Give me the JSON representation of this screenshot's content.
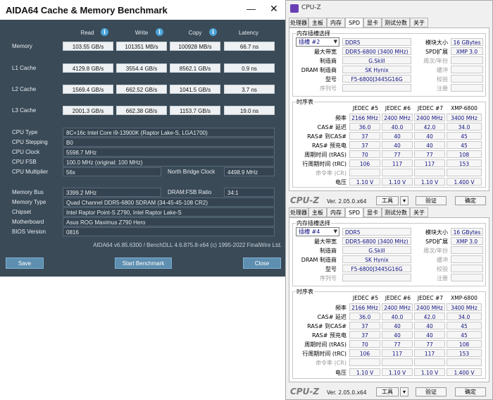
{
  "aida": {
    "title": "AIDA64 Cache & Memory Benchmark",
    "min_glyph": "—",
    "close_glyph": "✕",
    "headers": [
      "Read",
      "Write",
      "Copy",
      "Latency"
    ],
    "info_glyph": "i",
    "rows": [
      {
        "label": "Memory",
        "read": "103.55 GB/s",
        "write": "101351 MB/s",
        "copy": "100928 MB/s",
        "latency": "66.7 ns"
      },
      {
        "label": "L1 Cache",
        "read": "4129.8 GB/s",
        "write": "3554.4 GB/s",
        "copy": "8562.1 GB/s",
        "latency": "0.9 ns"
      },
      {
        "label": "L2 Cache",
        "read": "1569.4 GB/s",
        "write": "662.52 GB/s",
        "copy": "1041.5 GB/s",
        "latency": "3.7 ns"
      },
      {
        "label": "L3 Cache",
        "read": "2001.3 GB/s",
        "write": "662.38 GB/s",
        "copy": "1153.7 GB/s",
        "latency": "19.0 ns"
      }
    ],
    "cpu": {
      "type_label": "CPU Type",
      "type": "8C+16c Intel Core i9-13900K  (Raptor Lake-S, LGA1700)",
      "stepping_label": "CPU Stepping",
      "stepping": "B0",
      "clock_label": "CPU Clock",
      "clock": "5598.7 MHz",
      "fsb_label": "CPU FSB",
      "fsb": "100.0 MHz  (original: 100 MHz)",
      "mult_label": "CPU Multiplier",
      "mult": "56x",
      "nb_label": "North Bridge Clock",
      "nb": "4498.9 MHz"
    },
    "mem": {
      "bus_label": "Memory Bus",
      "bus": "3399.2 MHz",
      "ratio_label": "DRAM:FSB Ratio",
      "ratio": "34:1",
      "type_label": "Memory Type",
      "type": "Quad Channel DDR5-6800 SDRAM  (34-45-45-108 CR2)",
      "chipset_label": "Chipset",
      "chipset": "Intel Raptor Point-S Z790, Intel Raptor Lake-S",
      "mb_label": "Motherboard",
      "mb": "Asus ROG Maximus Z790 Hero",
      "bios_label": "BIOS Version",
      "bios": "0816"
    },
    "footer": "AIDA64 v6.85.6300 / BenchDLL 4.6.875.8-x64  (c) 1995-2022 FinalWire Ltd.",
    "buttons": {
      "save": "Save",
      "start": "Start Benchmark",
      "close": "Close"
    }
  },
  "cpuz_title": "CPU-Z",
  "cpuz_tabs": [
    "处理器",
    "主板",
    "内存",
    "SPD",
    "显卡",
    "测试分数",
    "关于"
  ],
  "cpuz": [
    {
      "slot_group": "内存插槽选择",
      "slot": "插槽 #2",
      "type": "DDR5",
      "module_size_label": "模块大小",
      "module_size": "16 GBytes",
      "max_bw_label": "最大带宽",
      "max_bw": "DDR5-6800 (3400 MHz)",
      "spd_ext_label": "SPD扩展",
      "spd_ext": "XMP 3.0",
      "maker_label": "制造商",
      "maker": "G.Skill",
      "week_year_label": "周次/年份",
      "dram_maker_label": "DRAM 制造商",
      "dram_maker": "SK Hynix",
      "buffered_label": "缓冲",
      "part_label": "型号",
      "part": "F5-6800J3445G16G",
      "correction_label": "校验",
      "serial_label": "序列号",
      "registered_label": "注册",
      "timing_group": "时序表",
      "timing_cols": [
        "JEDEC #5",
        "JEDEC #6",
        "JEDEC #7",
        "XMP-6800"
      ],
      "timing_rows": [
        {
          "label": "频率",
          "vals": [
            "2166 MHz",
            "2400 MHz",
            "2400 MHz",
            "3400 MHz"
          ]
        },
        {
          "label": "CAS# 延迟",
          "vals": [
            "36.0",
            "40.0",
            "42.0",
            "34.0"
          ]
        },
        {
          "label": "RAS# 到CAS#",
          "vals": [
            "37",
            "40",
            "40",
            "45"
          ]
        },
        {
          "label": "RAS# 预充电",
          "vals": [
            "37",
            "40",
            "40",
            "45"
          ]
        },
        {
          "label": "周期时间 (tRAS)",
          "vals": [
            "70",
            "77",
            "77",
            "108"
          ]
        },
        {
          "label": "行周期时间 (tRC)",
          "vals": [
            "106",
            "117",
            "117",
            "153"
          ]
        },
        {
          "label": "命令率 (CR)",
          "vals": [
            "",
            "",
            "",
            ""
          ]
        },
        {
          "label": "电压",
          "vals": [
            "1.10 V",
            "1.10 V",
            "1.10 V",
            "1.400 V"
          ]
        }
      ],
      "version": "Ver. 2.05.0.x64",
      "tools": "工具",
      "validate": "验证",
      "ok": "确定"
    },
    {
      "slot_group": "内存插槽选择",
      "slot": "插槽 #4",
      "type": "DDR5",
      "module_size_label": "模块大小",
      "module_size": "16 GBytes",
      "max_bw_label": "最大带宽",
      "max_bw": "DDR5-6800 (3400 MHz)",
      "spd_ext_label": "SPD扩展",
      "spd_ext": "XMP 3.0",
      "maker_label": "制造商",
      "maker": "G.Skill",
      "week_year_label": "周次/年份",
      "dram_maker_label": "DRAM 制造商",
      "dram_maker": "SK Hynix",
      "buffered_label": "缓冲",
      "part_label": "型号",
      "part": "F5-6800J3445G16G",
      "correction_label": "校验",
      "serial_label": "序列号",
      "registered_label": "注册",
      "timing_group": "时序表",
      "timing_cols": [
        "JEDEC #5",
        "JEDEC #6",
        "JEDEC #7",
        "XMP-6800"
      ],
      "timing_rows": [
        {
          "label": "频率",
          "vals": [
            "2166 MHz",
            "2400 MHz",
            "2400 MHz",
            "3400 MHz"
          ]
        },
        {
          "label": "CAS# 延迟",
          "vals": [
            "36.0",
            "40.0",
            "42.0",
            "34.0"
          ]
        },
        {
          "label": "RAS# 到CAS#",
          "vals": [
            "37",
            "40",
            "40",
            "45"
          ]
        },
        {
          "label": "RAS# 预充电",
          "vals": [
            "37",
            "40",
            "40",
            "45"
          ]
        },
        {
          "label": "周期时间 (tRAS)",
          "vals": [
            "70",
            "77",
            "77",
            "108"
          ]
        },
        {
          "label": "行周期时间 (tRC)",
          "vals": [
            "106",
            "117",
            "117",
            "153"
          ]
        },
        {
          "label": "命令率 (CR)",
          "vals": [
            "",
            "",
            "",
            ""
          ]
        },
        {
          "label": "电压",
          "vals": [
            "1.10 V",
            "1.10 V",
            "1.10 V",
            "1.400 V"
          ]
        }
      ],
      "version": "Ver. 2.05.0.x64",
      "tools": "工具",
      "validate": "验证",
      "ok": "确定"
    }
  ]
}
